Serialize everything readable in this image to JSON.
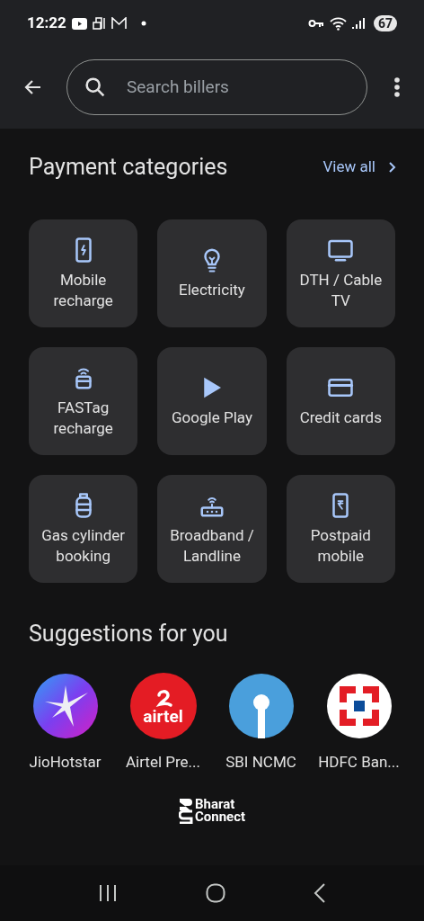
{
  "status_bar": {
    "time": "12:22",
    "battery": "67"
  },
  "search": {
    "placeholder": "Search billers"
  },
  "categories_section": {
    "title": "Payment categories",
    "link": "View all"
  },
  "categories": [
    {
      "label": "Mobile recharge",
      "kind": "mobile"
    },
    {
      "label": "Electricity",
      "kind": "electricity"
    },
    {
      "label": "DTH / Cable TV",
      "kind": "dth"
    },
    {
      "label": "FASTag recharge",
      "kind": "fastag"
    },
    {
      "label": "Google Play",
      "kind": "play"
    },
    {
      "label": "Credit cards",
      "kind": "card"
    },
    {
      "label": "Gas cylinder booking",
      "kind": "gas"
    },
    {
      "label": "Broadband / Landline",
      "kind": "broadband"
    },
    {
      "label": "Postpaid mobile",
      "kind": "postpaid"
    }
  ],
  "suggestions_section": {
    "title": "Suggestions for you"
  },
  "suggestions": [
    {
      "label": "JioHotstar",
      "kind": "star"
    },
    {
      "label": "Airtel Pre...",
      "kind": "airtel",
      "logo_text": "airtel"
    },
    {
      "label": "SBI NCMC",
      "kind": "sbi"
    },
    {
      "label": "HDFC Ban...",
      "kind": "hdfc"
    }
  ],
  "footer": {
    "brand_line_1": "Bharat",
    "brand_line_2": "Connect"
  }
}
